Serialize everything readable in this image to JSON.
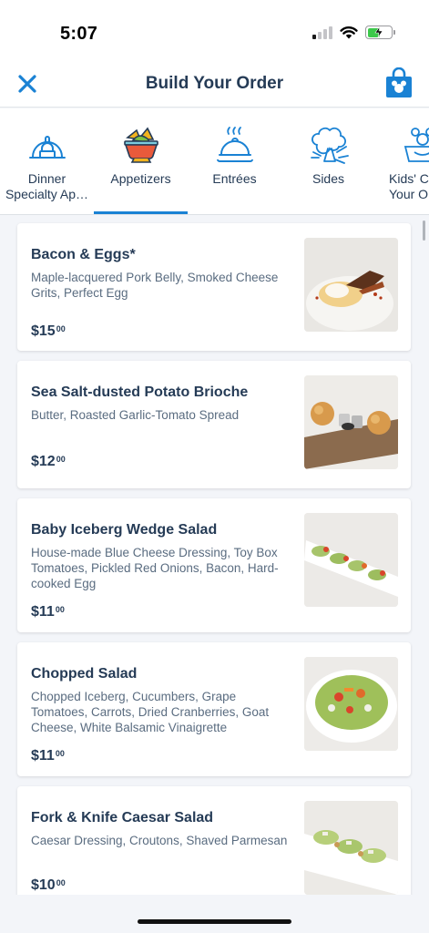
{
  "status_bar": {
    "time": "5:07"
  },
  "header": {
    "title": "Build Your Order",
    "close_icon": "close-icon",
    "bag_icon": "shopping-bag-icon"
  },
  "tabs": [
    {
      "label": "Dinner\nSpecialty Ap…",
      "icon": "cloche-lock-icon",
      "active": false
    },
    {
      "label": "Appetizers",
      "icon": "nacho-bowl-icon",
      "active": true
    },
    {
      "label": "Entrées",
      "icon": "covered-dish-icon",
      "active": false
    },
    {
      "label": "Sides",
      "icon": "broccoli-icon",
      "active": false
    },
    {
      "label": "Kids' Cr\nYour O",
      "icon": "kids-meal-icon",
      "active": false
    }
  ],
  "items": [
    {
      "name": "Bacon & Eggs*",
      "description": "Maple-lacquered Pork Belly, Smoked Cheese Grits, Perfect Egg",
      "price_main": "$15",
      "price_cents": "00"
    },
    {
      "name": "Sea Salt-dusted Potato Brioche",
      "description": "Butter, Roasted Garlic-Tomato Spread",
      "price_main": "$12",
      "price_cents": "00"
    },
    {
      "name": "Baby Iceberg Wedge Salad",
      "description": "House-made Blue Cheese Dressing, Toy Box Tomatoes, Pickled Red Onions, Bacon, Hard-cooked Egg",
      "price_main": "$11",
      "price_cents": "00"
    },
    {
      "name": "Chopped Salad",
      "description": "Chopped Iceberg, Cucumbers, Grape Tomatoes, Carrots, Dried Cranberries, Goat Cheese, White Balsamic Vinaigrette",
      "price_main": "$11",
      "price_cents": "00"
    },
    {
      "name": "Fork & Knife Caesar Salad",
      "description": "Caesar Dressing, Croutons, Shaved Parmesan",
      "price_main": "$10",
      "price_cents": "00"
    }
  ],
  "colors": {
    "accent": "#1a82d4",
    "text": "#253b56",
    "muted": "#5a6c80"
  }
}
